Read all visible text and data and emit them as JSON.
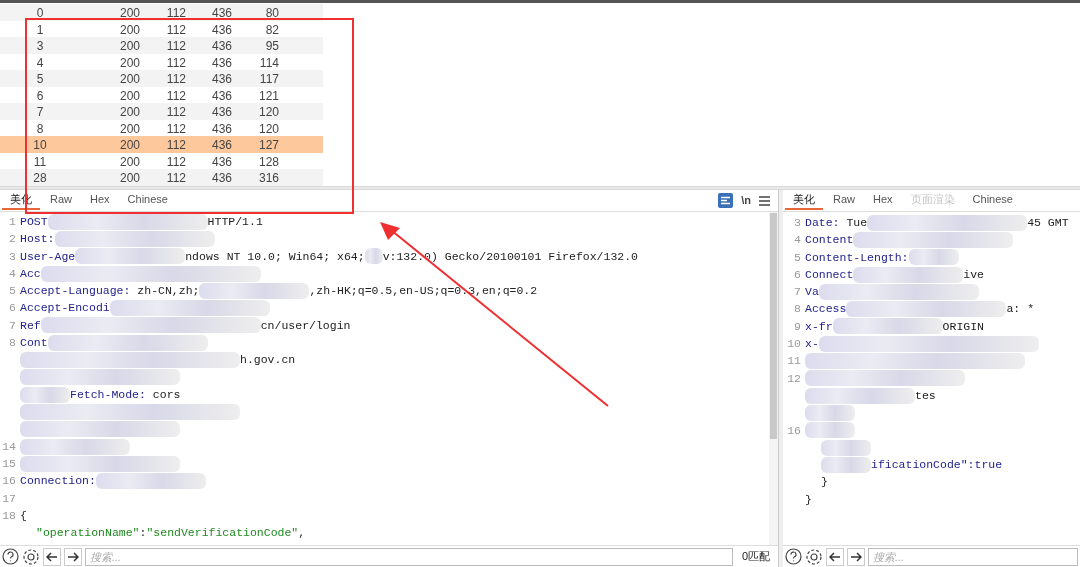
{
  "results_table": {
    "rows": [
      {
        "cells": [
          "0",
          "200",
          "112",
          "436",
          "80"
        ],
        "selected": false
      },
      {
        "cells": [
          "1",
          "200",
          "112",
          "436",
          "82"
        ],
        "selected": false
      },
      {
        "cells": [
          "3",
          "200",
          "112",
          "436",
          "95"
        ],
        "selected": false
      },
      {
        "cells": [
          "4",
          "200",
          "112",
          "436",
          "114"
        ],
        "selected": false
      },
      {
        "cells": [
          "5",
          "200",
          "112",
          "436",
          "117"
        ],
        "selected": false
      },
      {
        "cells": [
          "6",
          "200",
          "112",
          "436",
          "121"
        ],
        "selected": false
      },
      {
        "cells": [
          "7",
          "200",
          "112",
          "436",
          "120"
        ],
        "selected": false
      },
      {
        "cells": [
          "8",
          "200",
          "112",
          "436",
          "120"
        ],
        "selected": false
      },
      {
        "cells": [
          "10",
          "200",
          "112",
          "436",
          "127"
        ],
        "selected": true
      },
      {
        "cells": [
          "11",
          "200",
          "112",
          "436",
          "128"
        ],
        "selected": false
      },
      {
        "cells": [
          "28",
          "200",
          "112",
          "436",
          "316"
        ],
        "selected": false
      }
    ]
  },
  "request_pane": {
    "tabs": [
      {
        "label": "美化",
        "selected": true,
        "disabled": false
      },
      {
        "label": "Raw",
        "selected": false,
        "disabled": false
      },
      {
        "label": "Hex",
        "selected": false,
        "disabled": false
      },
      {
        "label": "Chinese",
        "selected": false,
        "disabled": false
      }
    ],
    "toolbar": {
      "pretty_on": true,
      "newline_label": "\\n"
    },
    "lines": [
      {
        "num": "1",
        "segments": [
          {
            "kind": "key",
            "text": "POST"
          },
          {
            "kind": "mask"
          },
          {
            "kind": "text",
            "text": "HTTP/1.1"
          }
        ]
      },
      {
        "num": "2",
        "segments": [
          {
            "kind": "key",
            "text": "Host:"
          },
          {
            "kind": "mask"
          }
        ]
      },
      {
        "num": "3",
        "segments": [
          {
            "kind": "key",
            "text": "User-Age"
          },
          {
            "kind": "mask"
          },
          {
            "kind": "text",
            "text": "ndows NT 10.0; Win64; x64;"
          },
          {
            "kind": "mask"
          },
          {
            "kind": "text",
            "text": "v:132.0) Gecko/20100101 Firefox/132.0"
          }
        ]
      },
      {
        "num": "4",
        "segments": [
          {
            "kind": "key",
            "text": "Acc"
          },
          {
            "kind": "mask"
          }
        ]
      },
      {
        "num": "5",
        "segments": [
          {
            "kind": "key",
            "text": "Accept-Language:"
          },
          {
            "kind": "text",
            "text": " zh-CN,zh;"
          },
          {
            "kind": "mask"
          },
          {
            "kind": "text",
            "text": ",zh-HK;q=0.5,en-US;q=0.3,en;q=0.2"
          }
        ]
      },
      {
        "num": "6",
        "segments": [
          {
            "kind": "key",
            "text": "Accept-Encodi"
          },
          {
            "kind": "mask"
          }
        ]
      },
      {
        "num": "7",
        "segments": [
          {
            "kind": "key",
            "text": "Ref"
          },
          {
            "kind": "mask"
          },
          {
            "kind": "text",
            "text": "cn/user/login"
          }
        ]
      },
      {
        "num": "8",
        "segments": [
          {
            "kind": "key",
            "text": "Cont"
          },
          {
            "kind": "mask"
          }
        ]
      },
      {
        "segments": [
          {
            "kind": "mask"
          },
          {
            "kind": "text",
            "text": "h.gov.cn"
          }
        ]
      },
      {
        "segments": [
          {
            "kind": "mask"
          }
        ]
      },
      {
        "segments": [
          {
            "kind": "mask"
          },
          {
            "kind": "key",
            "text": "Fetch-Mode:"
          },
          {
            "kind": "text",
            "text": " cors"
          }
        ]
      },
      {
        "segments": [
          {
            "kind": "mask"
          }
        ]
      },
      {
        "segments": [
          {
            "kind": "mask"
          }
        ]
      },
      {
        "num": "14",
        "segments": [
          {
            "kind": "mask"
          }
        ]
      },
      {
        "num": "15",
        "segments": [
          {
            "kind": "mask"
          }
        ]
      },
      {
        "num": "16",
        "segments": [
          {
            "kind": "key",
            "text": "Connection:"
          },
          {
            "kind": "mask"
          }
        ]
      },
      {
        "num": "17"
      },
      {
        "num": "18",
        "segments": [
          {
            "kind": "punct",
            "text": "{"
          }
        ]
      },
      {
        "segments": [
          {
            "kind": "indent"
          },
          {
            "kind": "string",
            "text": "\"operationName\""
          },
          {
            "kind": "punct",
            "text": ":"
          },
          {
            "kind": "string",
            "text": "\"sendVerificationCode\""
          },
          {
            "kind": "punct",
            "text": ","
          }
        ]
      }
    ],
    "search": {
      "placeholder": "搜索...",
      "matches": "0匹配"
    }
  },
  "response_pane": {
    "tabs": [
      {
        "label": "美化",
        "selected": true,
        "disabled": false
      },
      {
        "label": "Raw",
        "selected": false,
        "disabled": false
      },
      {
        "label": "Hex",
        "selected": false,
        "disabled": false
      },
      {
        "label": "页面渲染",
        "selected": false,
        "disabled": true
      },
      {
        "label": "Chinese",
        "selected": false,
        "disabled": false
      }
    ],
    "lines": [
      {
        "num": "3",
        "segments": [
          {
            "kind": "key",
            "text": "Date:"
          },
          {
            "kind": "text",
            "text": " Tue"
          },
          {
            "kind": "mask"
          },
          {
            "kind": "text",
            "text": "45 GMT"
          }
        ]
      },
      {
        "num": "4",
        "segments": [
          {
            "kind": "key",
            "text": "Content"
          },
          {
            "kind": "mask"
          }
        ]
      },
      {
        "num": "5",
        "segments": [
          {
            "kind": "key",
            "text": "Content-Length:"
          },
          {
            "kind": "mask"
          }
        ]
      },
      {
        "num": "6",
        "segments": [
          {
            "kind": "key",
            "text": "Connect"
          },
          {
            "kind": "mask"
          },
          {
            "kind": "text",
            "text": "ive"
          }
        ]
      },
      {
        "num": "7",
        "segments": [
          {
            "kind": "key",
            "text": "Va"
          },
          {
            "kind": "mask"
          }
        ]
      },
      {
        "num": "8",
        "segments": [
          {
            "kind": "key",
            "text": "Access"
          },
          {
            "kind": "mask"
          },
          {
            "kind": "text",
            "text": "a: *"
          }
        ]
      },
      {
        "num": "9",
        "segments": [
          {
            "kind": "key",
            "text": "x-fr"
          },
          {
            "kind": "mask"
          },
          {
            "kind": "text",
            "text": "ORIGIN"
          }
        ]
      },
      {
        "num": "10",
        "segments": [
          {
            "kind": "key",
            "text": "x-"
          },
          {
            "kind": "mask"
          }
        ]
      },
      {
        "num": "11",
        "segments": [
          {
            "kind": "mask"
          }
        ]
      },
      {
        "num": "12",
        "segments": [
          {
            "kind": "mask"
          }
        ]
      },
      {
        "segments": [
          {
            "kind": "mask"
          },
          {
            "kind": "text",
            "text": "tes"
          }
        ]
      },
      {
        "segments": [
          {
            "kind": "mask"
          }
        ]
      },
      {
        "num": "16",
        "segments": [
          {
            "kind": "mask"
          }
        ]
      },
      {
        "segments": [
          {
            "kind": "indent"
          },
          {
            "kind": "mask"
          }
        ]
      },
      {
        "segments": [
          {
            "kind": "indent"
          },
          {
            "kind": "mask"
          },
          {
            "kind": "key",
            "text": "ificationCode\":true"
          }
        ]
      },
      {
        "segments": [
          {
            "kind": "indent"
          },
          {
            "kind": "punct",
            "text": "}"
          }
        ]
      },
      {
        "segments": [
          {
            "kind": "punct",
            "text": "}"
          }
        ]
      }
    ],
    "search": {
      "placeholder": "搜索..."
    }
  }
}
